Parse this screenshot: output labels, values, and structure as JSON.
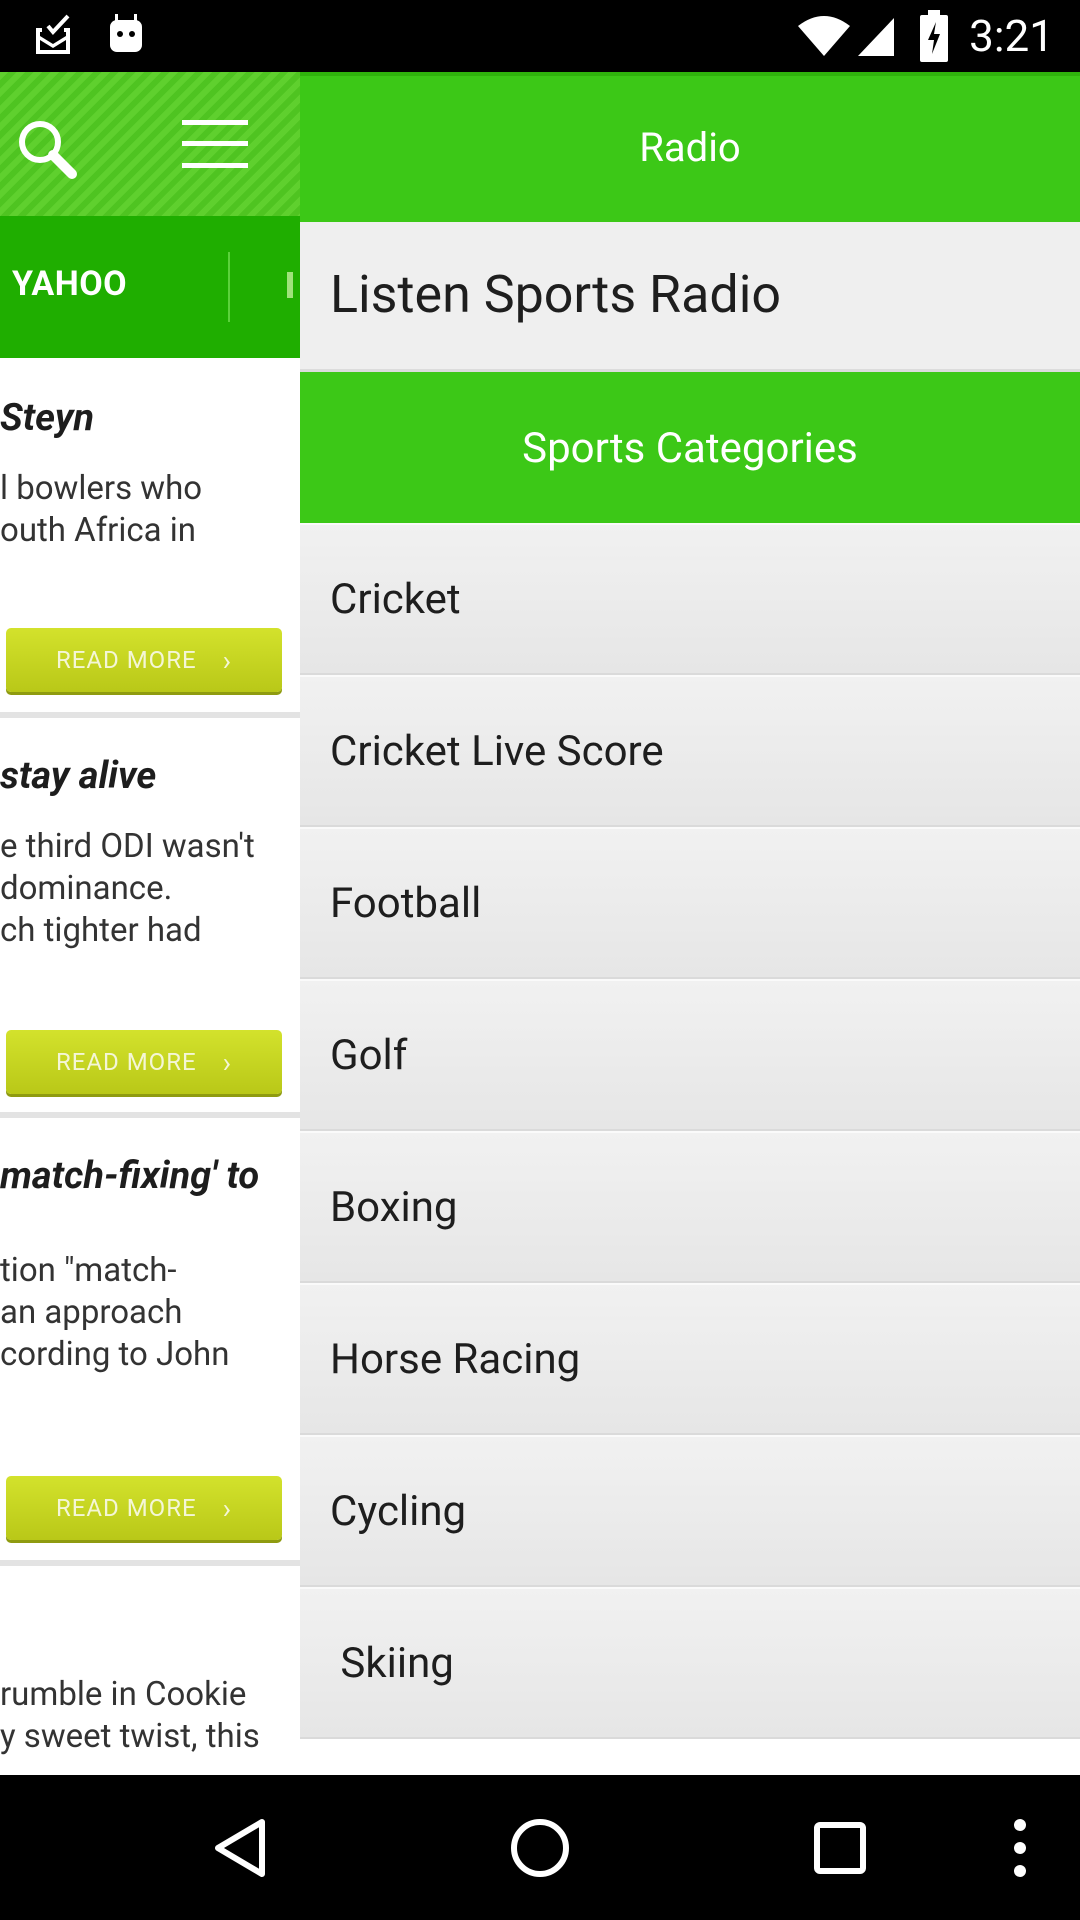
{
  "status_bar": {
    "time": "3:21",
    "icons": [
      "mail-notification-icon",
      "android-icon",
      "wifi-icon",
      "signal-icon",
      "battery-charging-icon"
    ]
  },
  "background_app": {
    "header_icons": [
      "search-icon",
      "menu-icon"
    ],
    "tab": "YAHOO",
    "articles": [
      {
        "title": "Steyn",
        "snippet": [
          "l bowlers who",
          "outh Africa in"
        ],
        "button": "READ MORE"
      },
      {
        "title": "stay alive",
        "snippet": [
          "e third ODI wasn't",
          "dominance.",
          "ch tighter had"
        ],
        "button": "READ MORE"
      },
      {
        "title": "match-fixing' to",
        "snippet": [
          "tion \"match-",
          " an approach",
          "cording to John"
        ],
        "button": "READ MORE"
      },
      {
        "title": "",
        "snippet": [
          "rumble in Cookie",
          "y sweet twist, this"
        ],
        "button": ""
      }
    ]
  },
  "drawer": {
    "header_title": "Radio",
    "subtitle": "Listen Sports Radio",
    "section_title": "Sports Categories",
    "categories": [
      "Cricket",
      "Cricket Live Score",
      "Football",
      "Golf",
      "Boxing",
      "Horse Racing",
      "Cycling",
      " Skiing"
    ],
    "accent_color": "#3cc817"
  },
  "nav_bar": {
    "icons": [
      "back-icon",
      "home-icon",
      "recents-icon",
      "overflow-menu-icon"
    ]
  }
}
